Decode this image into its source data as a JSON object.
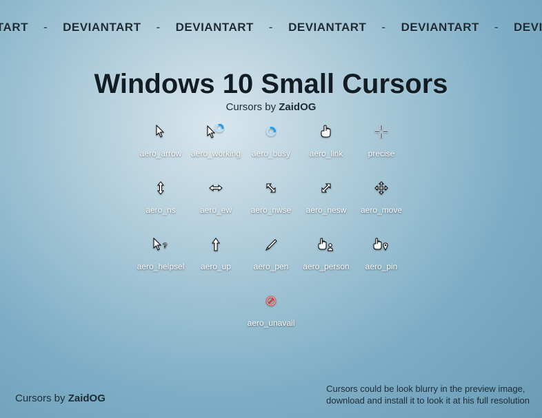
{
  "watermark_word": "DEVIANTART",
  "watermark_separator": "-",
  "title": "Windows 10 Small Cursors",
  "subtitle_prefix": "Cursors by ",
  "author": "ZaidOG",
  "cursors": {
    "row1": [
      {
        "name": "aero_arrow"
      },
      {
        "name": "aero_working"
      },
      {
        "name": "aero_busy"
      },
      {
        "name": "aero_link"
      },
      {
        "name": "precise"
      }
    ],
    "row2": [
      {
        "name": "aero_ns"
      },
      {
        "name": "aero_ew"
      },
      {
        "name": "aero_nwse"
      },
      {
        "name": "aero_nesw"
      },
      {
        "name": "aero_move"
      }
    ],
    "row3": [
      {
        "name": "aero_helpsel"
      },
      {
        "name": "aero_up"
      },
      {
        "name": "aero_pen"
      },
      {
        "name": "aero_person"
      },
      {
        "name": "aero_pin"
      }
    ],
    "row4": [
      {
        "name": "aero_unavail"
      }
    ]
  },
  "footer_left_prefix": "Cursors by ",
  "footer_right_line1": "Cursors could be look blurry in the preview image,",
  "footer_right_line2": "download and install it to look it at his full resolution",
  "colors": {
    "accent_blue": "#1a9fef",
    "unavail_red": "#d83b3b"
  }
}
